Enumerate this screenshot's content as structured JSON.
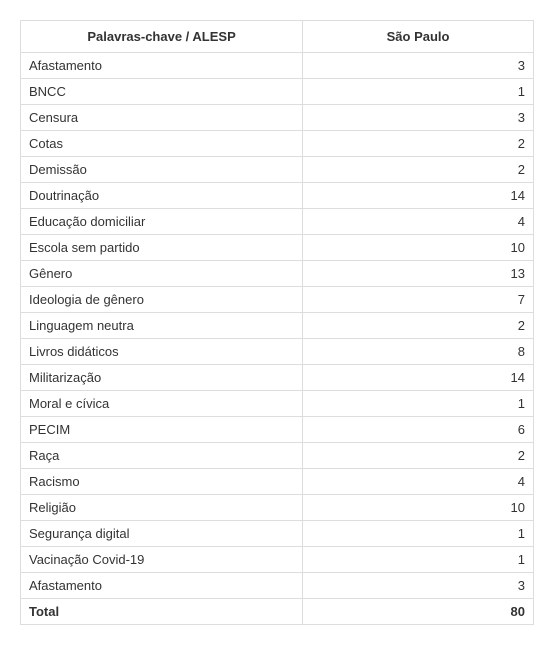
{
  "chart_data": {
    "type": "table",
    "headers": [
      "Palavras-chave / ALESP",
      "São Paulo"
    ],
    "rows": [
      {
        "label": "Afastamento",
        "value": 3
      },
      {
        "label": "BNCC",
        "value": 1
      },
      {
        "label": "Censura",
        "value": 3
      },
      {
        "label": "Cotas",
        "value": 2
      },
      {
        "label": "Demissão",
        "value": 2
      },
      {
        "label": "Doutrinação",
        "value": 14
      },
      {
        "label": "Educação domiciliar",
        "value": 4
      },
      {
        "label": "Escola sem partido",
        "value": 10
      },
      {
        "label": "Gênero",
        "value": 13
      },
      {
        "label": "Ideologia de gênero",
        "value": 7
      },
      {
        "label": "Linguagem neutra",
        "value": 2
      },
      {
        "label": "Livros didáticos",
        "value": 8
      },
      {
        "label": "Militarização",
        "value": 14
      },
      {
        "label": "Moral e cívica",
        "value": 1
      },
      {
        "label": "PECIM",
        "value": 6
      },
      {
        "label": "Raça",
        "value": 2
      },
      {
        "label": "Racismo",
        "value": 4
      },
      {
        "label": "Religião",
        "value": 10
      },
      {
        "label": "Segurança digital",
        "value": 1
      },
      {
        "label": "Vacinação Covid-19",
        "value": 1
      },
      {
        "label": "Afastamento",
        "value": 3
      }
    ],
    "total": {
      "label": "Total",
      "value": 80
    }
  }
}
